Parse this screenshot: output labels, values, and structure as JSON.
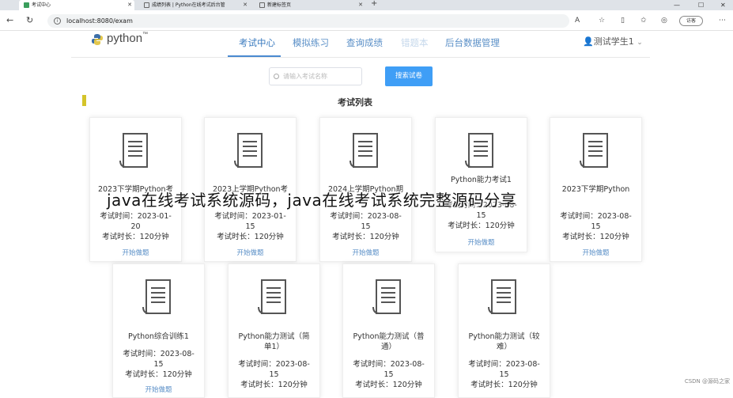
{
  "browser": {
    "tabs": [
      {
        "title": "考试中心"
      },
      {
        "title": "成绩列表 | Python在线考试后台管"
      },
      {
        "title": "新建标签页"
      }
    ],
    "url": "localhost:8080/exam",
    "visit_label": "访客"
  },
  "site": {
    "logo_text": "python",
    "logo_tm": "™",
    "nav": [
      "考试中心",
      "模拟练习",
      "查询成绩",
      "错题本",
      "后台数据管理"
    ],
    "user": "测试学生1"
  },
  "search": {
    "placeholder": "请输入考试名称",
    "button": "搜索试卷"
  },
  "section_title": "考试列表",
  "cards": [
    {
      "title": "2023下学期Python考",
      "time_label": "考试时间：2023-01-",
      "time_tail": "20",
      "duration": "考试时长：120分钟",
      "action": "开始做题"
    },
    {
      "title": "2023上学期Python考",
      "time_label": "考试时间：2023-01-",
      "time_tail": "15",
      "duration": "考试时长：120分钟",
      "action": "开始做题"
    },
    {
      "title": "2024上学期Python期",
      "time_label": "考试时间：2023-08-",
      "time_tail": "15",
      "duration": "考试时长：120分钟",
      "action": "开始做题"
    },
    {
      "title": "Python能力考试1",
      "time_label": "考试时间：2023-08-",
      "time_tail": "15",
      "duration": "考试时长：120分钟",
      "action": "开始做题"
    },
    {
      "title": "2023下学期Python",
      "time_label": "考试时间：2023-08-",
      "time_tail": "15",
      "duration": "考试时长：120分钟",
      "action": "开始做题"
    },
    {
      "title": "Python综合训练1",
      "time_label": "考试时间：2023-08-",
      "time_tail": "15",
      "duration": "考试时长：120分钟",
      "action": "开始做题"
    },
    {
      "title": "Python能力测试（简",
      "title2": "单1）",
      "time_label": "考试时间：2023-08-",
      "time_tail": "15",
      "duration": "考试时长：120分钟"
    },
    {
      "title": "Python能力测试（普",
      "title2": "通）",
      "time_label": "考试时间：2023-08-",
      "time_tail": "15",
      "duration": "考试时长：120分钟"
    },
    {
      "title": "Python能力测试（较",
      "title2": "难）",
      "time_label": "考试时间：2023-08-",
      "time_tail": "15",
      "duration": "考试时长：120分钟"
    }
  ],
  "overlay_caption": "java在线考试系统源码，java在线考试系统完整源码分享",
  "watermark": "CSDN @源码之家"
}
